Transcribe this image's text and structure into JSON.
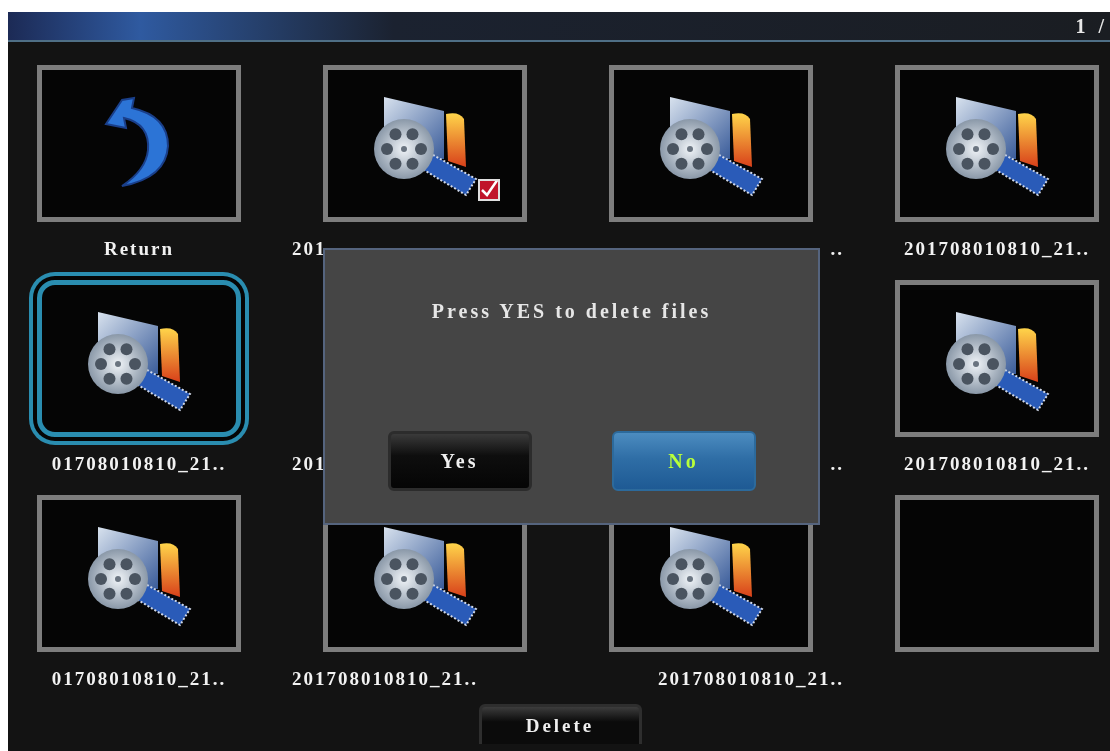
{
  "header": {
    "page": "1 /"
  },
  "tiles": [
    {
      "kind": "return",
      "label": "Return",
      "checked": false,
      "selected": false
    },
    {
      "kind": "video",
      "label": "201",
      "checked": true,
      "selected": false
    },
    {
      "kind": "video",
      "label": "..",
      "checked": false,
      "selected": false
    },
    {
      "kind": "video",
      "label": "201708010810_21..",
      "checked": false,
      "selected": false
    },
    {
      "kind": "video",
      "label": "01708010810_21..",
      "checked": false,
      "selected": true
    },
    {
      "kind": "covered",
      "label": "201"
    },
    {
      "kind": "covered",
      "label": ".."
    },
    {
      "kind": "video",
      "label": "201708010810_21..",
      "checked": false,
      "selected": false
    },
    {
      "kind": "video",
      "label": "01708010810_21..",
      "checked": false,
      "selected": false
    },
    {
      "kind": "video",
      "label": "201708010810_21..",
      "checked": false,
      "selected": false
    },
    {
      "kind": "video",
      "label": "201708010810_21..",
      "checked": false,
      "selected": false
    },
    {
      "kind": "empty",
      "checked": false,
      "selected": false
    }
  ],
  "dialog": {
    "message": "Press YES to delete files",
    "buttons": [
      {
        "label": "Yes",
        "selected": false
      },
      {
        "label": "No",
        "selected": true
      }
    ]
  },
  "delete_button": {
    "label": "Delete"
  }
}
